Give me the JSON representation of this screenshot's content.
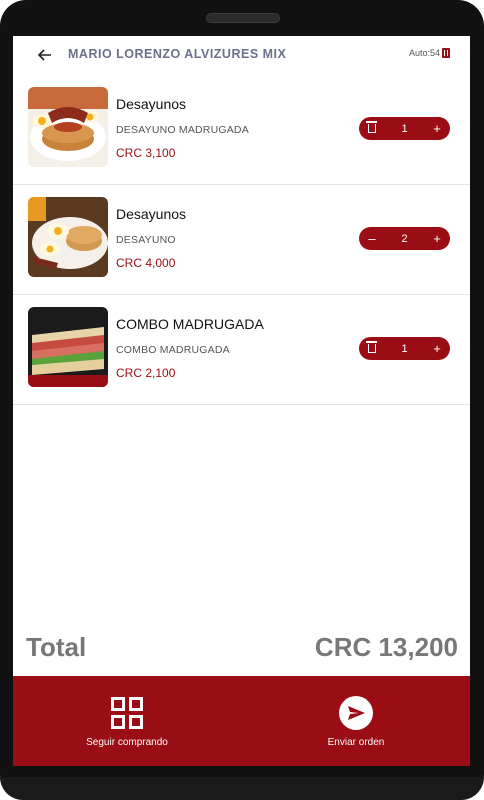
{
  "header": {
    "title": "MARIO LORENZO ALVIZURES MIX",
    "auto_label": "Auto:54"
  },
  "items": [
    {
      "name": "Desayunos",
      "description": "DESAYUNO MADRUGADA",
      "price": "CRC 3,100",
      "quantity": "1",
      "left_action_icon": "trash-icon"
    },
    {
      "name": "Desayunos",
      "description": "DESAYUNO",
      "price": "CRC 4,000",
      "quantity": "2",
      "left_action_icon": "minus-icon"
    },
    {
      "name": "COMBO MADRUGADA",
      "description": "COMBO MADRUGADA",
      "price": "CRC 2,100",
      "quantity": "1",
      "left_action_icon": "trash-icon"
    }
  ],
  "summary": {
    "total_label": "Total",
    "total_value": "CRC 13,200"
  },
  "footer": {
    "continue_label": "Seguir comprando",
    "send_label": "Enviar orden"
  },
  "colors": {
    "accent": "#9b0d14",
    "title": "#6b6f8a",
    "total": "#777777"
  }
}
